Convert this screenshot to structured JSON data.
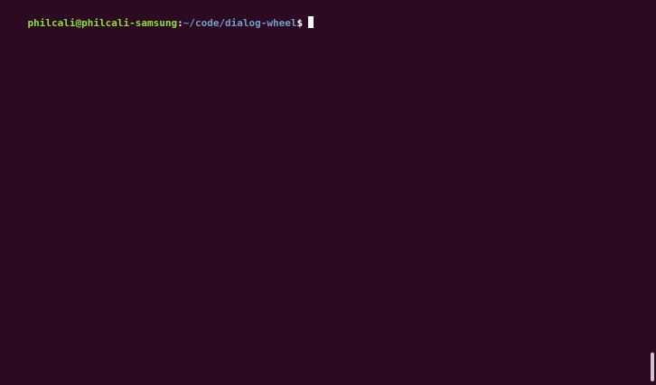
{
  "terminal": {
    "prompt": {
      "user_host": "philcali@philcali-samsung",
      "separator": ":",
      "path": "~/code/dialog-wheel",
      "symbol": "$"
    },
    "colors": {
      "background": "#2c0a22",
      "user_host": "#8ae234",
      "path": "#729fcf",
      "text": "#ffffff"
    }
  }
}
